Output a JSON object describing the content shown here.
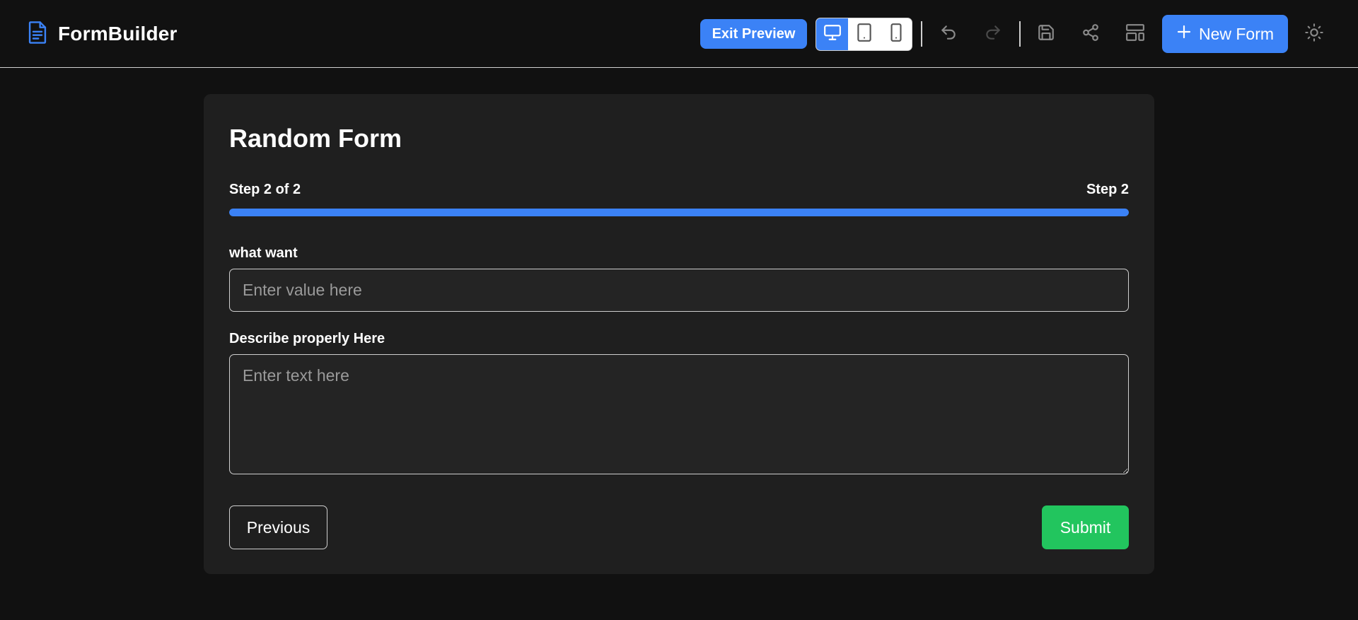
{
  "header": {
    "app_title": "FormBuilder",
    "app_icon": "document-icon",
    "exit_preview_label": "Exit Preview",
    "device_modes": [
      {
        "name": "desktop",
        "icon": "monitor-icon",
        "active": true
      },
      {
        "name": "tablet",
        "icon": "tablet-icon",
        "active": false
      },
      {
        "name": "mobile",
        "icon": "smartphone-icon",
        "active": false
      }
    ],
    "actions": [
      "undo-icon",
      "redo-icon",
      "save-icon",
      "share-icon",
      "layout-icon"
    ],
    "new_form_label": "New Form",
    "theme_toggle_icon": "sun-icon"
  },
  "form": {
    "title": "Random Form",
    "step_indicator": "Step 2 of 2",
    "step_name": "Step 2",
    "progress": 1.0,
    "fields": [
      {
        "label": "what want",
        "type": "text",
        "placeholder": "Enter value here",
        "value": ""
      },
      {
        "label": "Describe properly Here",
        "type": "textarea",
        "placeholder": "Enter text here",
        "value": ""
      }
    ],
    "previous_label": "Previous",
    "submit_label": "Submit"
  },
  "colors": {
    "accent": "#3b82f6",
    "success": "#22c55e",
    "background": "#111111",
    "card": "#1f1f1f"
  }
}
